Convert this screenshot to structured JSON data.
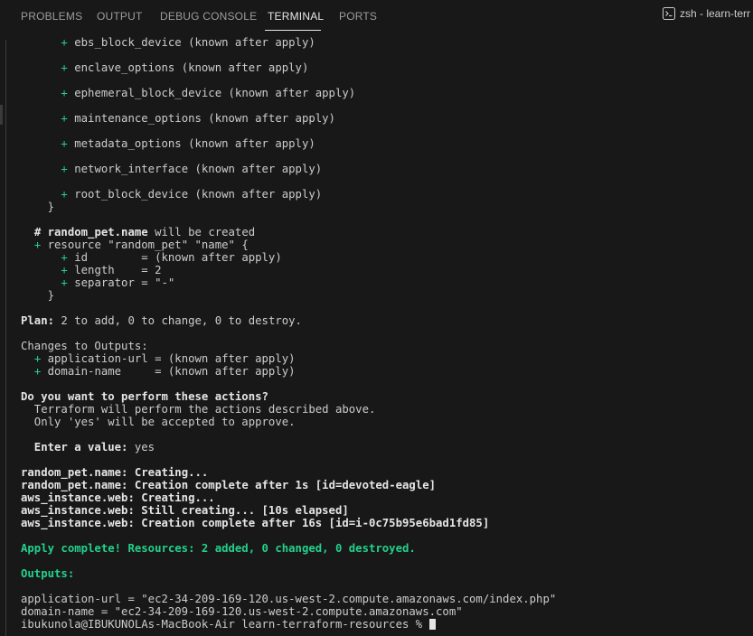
{
  "tabs": [
    "PROBLEMS",
    "OUTPUT",
    "DEBUG CONSOLE",
    "TERMINAL",
    "PORTS"
  ],
  "active_tab": "TERMINAL",
  "shell_label": "zsh - learn-terr",
  "plan": {
    "attrs": [
      "ebs_block_device (known after apply)",
      "enclave_options (known after apply)",
      "ephemeral_block_device (known after apply)",
      "maintenance_options (known after apply)",
      "metadata_options (known after apply)",
      "network_interface (known after apply)",
      "root_block_device (known after apply)"
    ],
    "close_brace": "}",
    "pet_comment_hash": "# ",
    "pet_comment_name": "random_pet.name",
    "pet_comment_rest": " will be created",
    "pet_resource": "resource \"random_pet\" \"name\" {",
    "pet_attrs": [
      "id        = (known after apply)",
      "length    = 2",
      "separator = \"-\""
    ],
    "plan_label": "Plan:",
    "plan_text": " 2 to add, 0 to change, 0 to destroy."
  },
  "outputs_changes": {
    "heading": "Changes to Outputs:",
    "items": [
      "application-url = (known after apply)",
      "domain-name     = (known after apply)"
    ]
  },
  "prompt": {
    "question": "Do you want to perform these actions?",
    "line1": "  Terraform will perform the actions described above.",
    "line2": "  Only 'yes' will be accepted to approve.",
    "enter_label": "  Enter a value:",
    "enter_value": " yes"
  },
  "progress": [
    {
      "label": "random_pet.name:",
      "text": " Creating..."
    },
    {
      "label": "random_pet.name:",
      "text": " Creation complete after 1s [id=devoted-eagle]"
    },
    {
      "label": "aws_instance.web:",
      "text": " Creating..."
    },
    {
      "label": "aws_instance.web:",
      "text": " Still creating... [10s elapsed]"
    },
    {
      "label": "aws_instance.web:",
      "text": " Creation complete after 16s [id=i-0c75b95e6bad1fd85]"
    }
  ],
  "apply_complete": "Apply complete! Resources: 2 added, 0 changed, 0 destroyed.",
  "outputs": {
    "heading": "Outputs:",
    "lines": [
      "application-url = \"ec2-34-209-169-120.us-west-2.compute.amazonaws.com/index.php\"",
      "domain-name = \"ec2-34-209-169-120.us-west-2.compute.amazonaws.com\""
    ]
  },
  "shell_prompt": "ibukunola@IBUKUNOLAs-MacBook-Air learn-terraform-resources % "
}
